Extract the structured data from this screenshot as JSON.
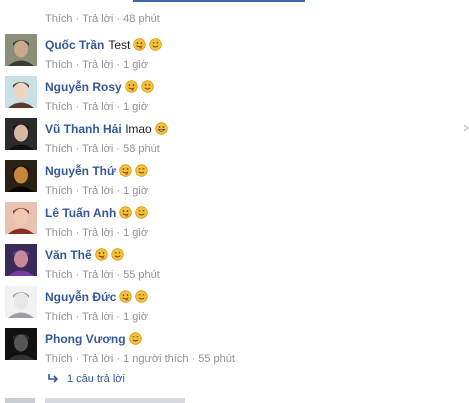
{
  "top_meta": {
    "like": "Thích",
    "reply": "Trả lời",
    "time": "48 phút"
  },
  "comments": [
    {
      "name": "Quốc Trần",
      "text": "Test",
      "emojis": [
        "tongue",
        "smile"
      ],
      "like": "Thích",
      "reply": "Trả lời",
      "time": "1 giờ",
      "likes": ""
    },
    {
      "name": "Nguyễn Rosy",
      "text": "",
      "emojis": [
        "tongue",
        "smile"
      ],
      "like": "Thích",
      "reply": "Trả lời",
      "time": "1 giờ",
      "likes": ""
    },
    {
      "name": "Vũ Thanh Hải",
      "text": "lmao",
      "emojis": [
        "grin"
      ],
      "like": "Thích",
      "reply": "Trả lời",
      "time": "58 phút",
      "likes": ""
    },
    {
      "name": "Nguyễn Thứ",
      "text": "",
      "emojis": [
        "tongue",
        "smile"
      ],
      "like": "Thích",
      "reply": "Trả lời",
      "time": "1 giờ",
      "likes": ""
    },
    {
      "name": "Lê Tuấn Anh",
      "text": "",
      "emojis": [
        "tongue",
        "smile"
      ],
      "like": "Thích",
      "reply": "Trả lời",
      "time": "1 giờ",
      "likes": ""
    },
    {
      "name": "Văn Thế",
      "text": "",
      "emojis": [
        "tongue",
        "smile"
      ],
      "like": "Thích",
      "reply": "Trả lời",
      "time": "55 phút",
      "likes": ""
    },
    {
      "name": "Nguyễn Đức",
      "text": "",
      "emojis": [
        "tongue",
        "smile"
      ],
      "like": "Thích",
      "reply": "Trả lời",
      "time": "1 giờ",
      "likes": ""
    },
    {
      "name": "Phong Vương",
      "text": "",
      "emojis": [
        "smile"
      ],
      "like": "Thích",
      "reply": "Trả lời",
      "time": "55 phút",
      "likes": "1 người thích"
    }
  ],
  "replies_link": "1 câu trả lời",
  "icons": {
    "reply_arrow": "reply-arrow-icon",
    "emoji_tongue": "tongue-emoji-icon",
    "emoji_smile": "smile-emoji-icon",
    "emoji_grin": "grin-emoji-icon"
  },
  "colors": {
    "name": "#365899",
    "meta": "#90949c",
    "text": "#1d2129",
    "emoji": "#f7c23a"
  }
}
